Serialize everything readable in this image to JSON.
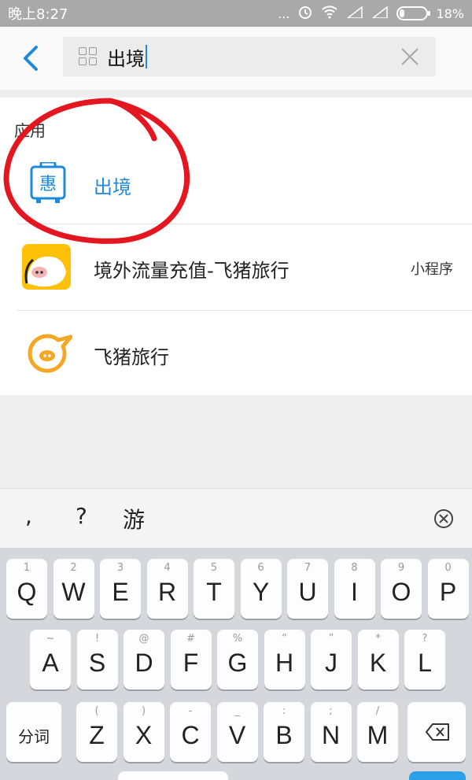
{
  "status_bar": {
    "time": "晚上8:27",
    "dots": "...",
    "battery_percent": "18%",
    "battery_level": 0.18
  },
  "search": {
    "query": "出境",
    "clear_icon": "close-icon",
    "back_icon": "back-arrow-icon",
    "grid_icon": "grid-icon"
  },
  "results": {
    "section_label": "应用",
    "items": [
      {
        "title": "出境",
        "tag": "",
        "icon": "luggage-discount-icon",
        "highlight_color": "#1f8ad9"
      },
      {
        "title": "境外流量充值-飞猪旅行",
        "tag": "小程序",
        "icon": "fliggy-pig-icon"
      },
      {
        "title": "飞猪旅行",
        "tag": "",
        "icon": "fliggy-logo-icon"
      }
    ]
  },
  "candidates": {
    "items": [
      ",",
      "?",
      "游"
    ],
    "close_icon": "close-circle-icon"
  },
  "keyboard": {
    "row1": [
      {
        "k": "Q",
        "s": "1"
      },
      {
        "k": "W",
        "s": "2"
      },
      {
        "k": "E",
        "s": "3"
      },
      {
        "k": "R",
        "s": "4"
      },
      {
        "k": "T",
        "s": "5"
      },
      {
        "k": "Y",
        "s": "6"
      },
      {
        "k": "U",
        "s": "7"
      },
      {
        "k": "I",
        "s": "8"
      },
      {
        "k": "O",
        "s": "9"
      },
      {
        "k": "P",
        "s": "0"
      }
    ],
    "row2": [
      {
        "k": "A",
        "s": "~"
      },
      {
        "k": "S",
        "s": "!"
      },
      {
        "k": "D",
        "s": "@"
      },
      {
        "k": "F",
        "s": "#"
      },
      {
        "k": "G",
        "s": "%"
      },
      {
        "k": "H",
        "s": "“"
      },
      {
        "k": "J",
        "s": "”"
      },
      {
        "k": "K",
        "s": "*"
      },
      {
        "k": "L",
        "s": "?"
      }
    ],
    "row3": [
      {
        "k": "Z",
        "s": "("
      },
      {
        "k": "X",
        "s": ")"
      },
      {
        "k": "C",
        "s": "-"
      },
      {
        "k": "V",
        "s": "_"
      },
      {
        "k": "B",
        "s": ":"
      },
      {
        "k": "N",
        "s": ";"
      },
      {
        "k": "M",
        "s": "/"
      }
    ],
    "segment_key": "分词",
    "delete_icon": "backspace-icon"
  },
  "colors": {
    "accent": "#1f8ad9",
    "annotation_red": "#e4161f"
  }
}
